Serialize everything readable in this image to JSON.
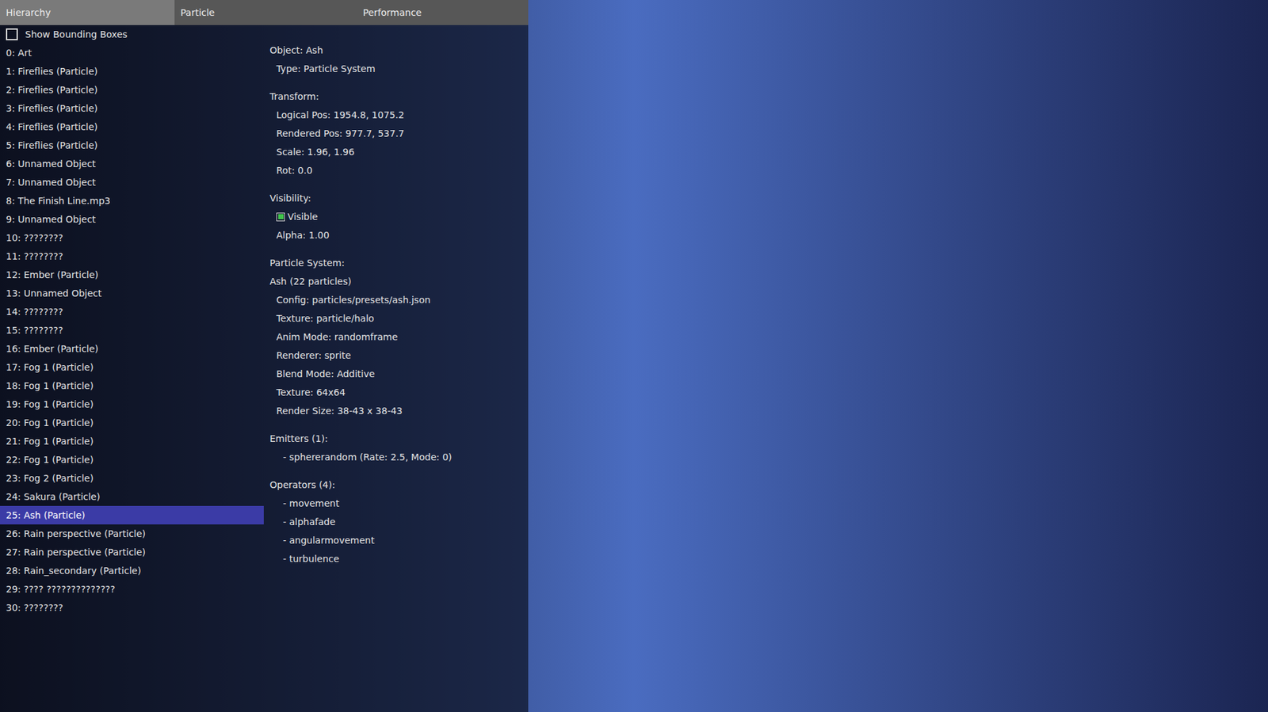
{
  "tabs": [
    {
      "label": "Hierarchy",
      "selected": true
    },
    {
      "label": "Particle",
      "selected": false
    },
    {
      "label": "Performance",
      "selected": false
    }
  ],
  "bounding_boxes": {
    "label": "Show Bounding Boxes",
    "checked": false
  },
  "hierarchy": [
    {
      "label": "0: Art",
      "selected": false
    },
    {
      "label": "1: Fireflies (Particle)",
      "selected": false
    },
    {
      "label": "2: Fireflies (Particle)",
      "selected": false
    },
    {
      "label": "3: Fireflies (Particle)",
      "selected": false
    },
    {
      "label": "4: Fireflies (Particle)",
      "selected": false
    },
    {
      "label": "5: Fireflies (Particle)",
      "selected": false
    },
    {
      "label": "6: Unnamed Object",
      "selected": false
    },
    {
      "label": "7: Unnamed Object",
      "selected": false
    },
    {
      "label": "8: The Finish Line.mp3",
      "selected": false
    },
    {
      "label": "9: Unnamed Object",
      "selected": false
    },
    {
      "label": "10: ????????",
      "selected": false
    },
    {
      "label": "11: ????????",
      "selected": false
    },
    {
      "label": "12: Ember (Particle)",
      "selected": false
    },
    {
      "label": "13: Unnamed Object",
      "selected": false
    },
    {
      "label": "14: ????????",
      "selected": false
    },
    {
      "label": "15: ????????",
      "selected": false
    },
    {
      "label": "16: Ember (Particle)",
      "selected": false
    },
    {
      "label": "17: Fog 1 (Particle)",
      "selected": false
    },
    {
      "label": "18: Fog 1 (Particle)",
      "selected": false
    },
    {
      "label": "19: Fog 1 (Particle)",
      "selected": false
    },
    {
      "label": "20: Fog 1 (Particle)",
      "selected": false
    },
    {
      "label": "21: Fog 1 (Particle)",
      "selected": false
    },
    {
      "label": "22: Fog 1 (Particle)",
      "selected": false
    },
    {
      "label": "23: Fog 2 (Particle)",
      "selected": false
    },
    {
      "label": "24: Sakura (Particle)",
      "selected": false
    },
    {
      "label": "25: Ash (Particle)",
      "selected": true
    },
    {
      "label": "26: Rain perspective (Particle)",
      "selected": false
    },
    {
      "label": "27: Rain perspective (Particle)",
      "selected": false
    },
    {
      "label": "28: Rain_secondary (Particle)",
      "selected": false
    },
    {
      "label": "29: ???? ??????????????",
      "selected": false
    },
    {
      "label": "30: ????????",
      "selected": false
    }
  ],
  "details": [
    {
      "heading": "Object: Ash",
      "lines": [
        {
          "kind": "text",
          "text": "Type: Particle System"
        }
      ]
    },
    {
      "heading": "Transform:",
      "lines": [
        {
          "kind": "text",
          "text": "Logical Pos: 1954.8, 1075.2"
        },
        {
          "kind": "text",
          "text": "Rendered Pos: 977.7, 537.7"
        },
        {
          "kind": "text",
          "text": "Scale: 1.96, 1.96"
        },
        {
          "kind": "text",
          "text": "Rot: 0.0"
        }
      ]
    },
    {
      "heading": "Visibility:",
      "lines": [
        {
          "kind": "checkbox",
          "text": "Visible",
          "checked": true
        },
        {
          "kind": "text",
          "text": "Alpha: 1.00"
        }
      ]
    },
    {
      "heading": "Particle System:",
      "lines": [
        {
          "kind": "subheading",
          "text": "Ash (22 particles)"
        },
        {
          "kind": "text",
          "text": "Config: particles/presets/ash.json"
        },
        {
          "kind": "text",
          "text": "Texture: particle/halo"
        },
        {
          "kind": "text",
          "text": "Anim Mode: randomframe"
        },
        {
          "kind": "text",
          "text": "Renderer: sprite"
        },
        {
          "kind": "text",
          "text": "Blend Mode: Additive"
        },
        {
          "kind": "text",
          "text": "Texture: 64x64"
        },
        {
          "kind": "text",
          "text": "Render Size: 38-43 x 38-43"
        }
      ]
    },
    {
      "heading": "Emitters (1):",
      "lines": [
        {
          "kind": "list",
          "text": "- sphererandom (Rate: 2.5, Mode: 0)"
        }
      ]
    },
    {
      "heading": "Operators (4):",
      "lines": [
        {
          "kind": "list",
          "text": "- movement"
        },
        {
          "kind": "list",
          "text": "- alphafade"
        },
        {
          "kind": "list",
          "text": "- angularmovement"
        },
        {
          "kind": "list",
          "text": "- turbulence"
        }
      ]
    }
  ]
}
